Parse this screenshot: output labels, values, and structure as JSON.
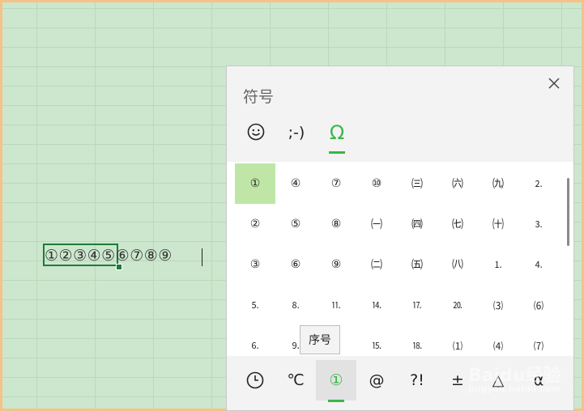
{
  "sheet": {
    "cell_value": "①②③④⑤⑥⑦⑧⑨"
  },
  "symbol_panel": {
    "title": "符号",
    "tabs": [
      {
        "name": "smiley",
        "label": ""
      },
      {
        "name": "emoticon",
        "label": ";-)"
      },
      {
        "name": "symbols",
        "label": "Ω",
        "active": true
      }
    ],
    "grid": [
      [
        "①",
        "④",
        "⑦",
        "⑩",
        "㈢",
        "㈥",
        "㈨",
        "⒉"
      ],
      [
        "②",
        "⑤",
        "⑧",
        "㈠",
        "㈣",
        "㈦",
        "㈩",
        "⒊"
      ],
      [
        "③",
        "⑥",
        "⑨",
        "㈡",
        "㈤",
        "㈧",
        "⒈",
        "⒋"
      ],
      [
        "⒌",
        "⒏",
        "⒒",
        "⒕",
        "⒘",
        "⒛",
        "⑶",
        "⑹"
      ],
      [
        "⒍",
        "⒐",
        "",
        "⒖",
        "⒙",
        "⑴",
        "⑷",
        "⑺"
      ]
    ],
    "selected_cell": "①",
    "tooltip": "序号",
    "recent": [
      {
        "name": "clock",
        "label": ""
      },
      {
        "name": "celsius",
        "label": "℃"
      },
      {
        "name": "circled-one",
        "label": "①"
      },
      {
        "name": "at-sign",
        "label": "@"
      },
      {
        "name": "interrobang",
        "label": "?!"
      },
      {
        "name": "plus-minus",
        "label": "±"
      },
      {
        "name": "triangle",
        "label": "△"
      },
      {
        "name": "alpha",
        "label": "α"
      }
    ],
    "accent_color": "#3bb54a"
  },
  "watermark": {
    "text": "Baidu经验",
    "sub": "jingyan.baidu.com"
  }
}
